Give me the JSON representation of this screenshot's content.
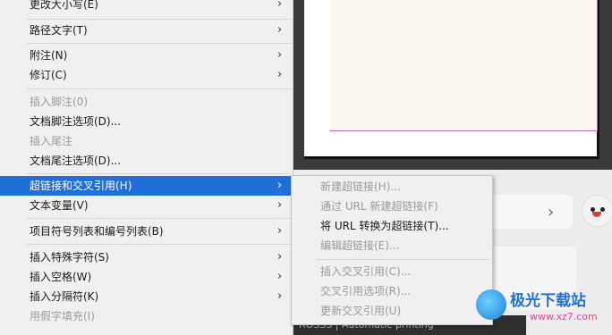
{
  "main_menu": {
    "items": [
      {
        "label": "更改大小写(E)",
        "submenu": true,
        "disabled": false
      },
      {
        "label": "路径文字(T)",
        "submenu": true,
        "disabled": false
      },
      {
        "label": "附注(N)",
        "submenu": true,
        "disabled": false
      },
      {
        "label": "修订(C)",
        "submenu": true,
        "disabled": false
      },
      {
        "label": "插入脚注(0)",
        "submenu": false,
        "disabled": true
      },
      {
        "label": "文档脚注选项(D)...",
        "submenu": false,
        "disabled": false
      },
      {
        "label": "插入尾注",
        "submenu": false,
        "disabled": true
      },
      {
        "label": "文档尾注选项(D)...",
        "submenu": false,
        "disabled": false
      },
      {
        "label": "超链接和交叉引用(H)",
        "submenu": true,
        "disabled": false,
        "active": true
      },
      {
        "label": "文本变量(V)",
        "submenu": true,
        "disabled": false
      },
      {
        "label": "项目符号列表和编号列表(B)",
        "submenu": true,
        "disabled": false
      },
      {
        "label": "插入特殊字符(S)",
        "submenu": true,
        "disabled": false
      },
      {
        "label": "插入空格(W)",
        "submenu": true,
        "disabled": false
      },
      {
        "label": "插入分隔符(K)",
        "submenu": true,
        "disabled": false
      },
      {
        "label": "用假字填充(I)",
        "submenu": false,
        "disabled": true
      }
    ],
    "arrow": "›"
  },
  "sub_menu": {
    "items": [
      {
        "label": "新建超链接(H)...",
        "disabled": true
      },
      {
        "label": "通过 URL 新建超链接(F)",
        "disabled": true
      },
      {
        "label": "将 URL 转换为超链接(T)...",
        "disabled": false
      },
      {
        "label": "编辑超链接(E)...",
        "disabled": true
      },
      {
        "label": "插入交叉引用(C)...",
        "disabled": true
      },
      {
        "label": "交叉引用选项(R)...",
        "disabled": true
      },
      {
        "label": "更新交叉引用(U)",
        "disabled": true
      }
    ]
  },
  "background": {
    "chevron": "›",
    "bottom_text": "ROSSS | Automatic printing"
  },
  "watermark": {
    "title": "极光下载站",
    "url": "www.xz7.com"
  },
  "colors": {
    "menu_bg": "#f0f0f0",
    "highlight": "#1f6fd6",
    "disabled_text": "#9a9a9a",
    "page_border": "#b06bb0"
  }
}
